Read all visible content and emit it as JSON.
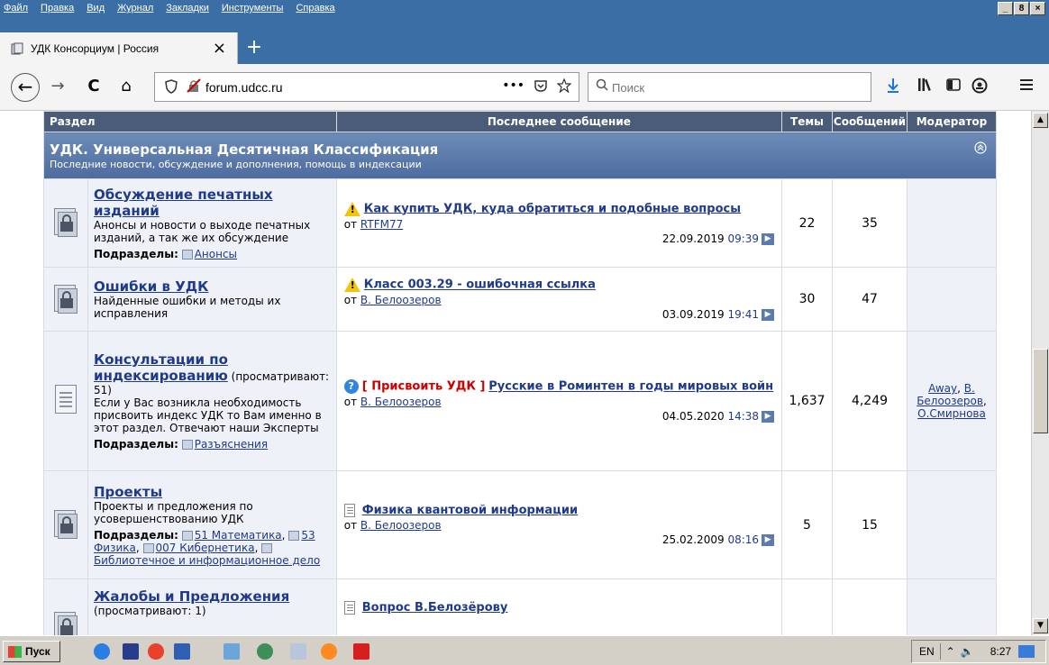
{
  "menubar": {
    "items": [
      "Файл",
      "Правка",
      "Вид",
      "Журнал",
      "Закладки",
      "Инструменты",
      "Справка"
    ],
    "controls": [
      "_",
      "8",
      "×"
    ]
  },
  "tab": {
    "title": "УДК Консорциум | Россия",
    "close": "×",
    "new_tab": "+"
  },
  "nav": {
    "back": "←",
    "forward": "→",
    "reload": "C",
    "home": "⌂",
    "url": "forum.udcc.ru",
    "search_placeholder": "Поиск",
    "page_actions": "•••"
  },
  "table": {
    "headers": {
      "section": "Раздел",
      "last_message": "Последнее сообщение",
      "topics": "Темы",
      "messages": "Сообщений",
      "moderator": "Модератор"
    },
    "category": {
      "title": "УДК. Универсальная Десятичная Классификация",
      "description": "Последние новости, обсуждение и дополнения, помощь в индексации"
    },
    "labels": {
      "subforums": "Подразделы:",
      "from": "от"
    },
    "forums": [
      {
        "name": "Обсуждение печатных изданий",
        "viewers": "",
        "description": "Анонсы и новости о выходе печатных изданий, а так же их обсуждение",
        "subforums": [
          "Анонсы"
        ],
        "last_topic": "Как купить УДК, куда обратиться и подобные вопросы",
        "last_prefix": "",
        "last_author": "RTFM77",
        "last_date": "22.09.2019",
        "last_time": "09:39",
        "topics": "22",
        "messages": "35",
        "moderators": []
      },
      {
        "name": "Ошибки в УДК",
        "viewers": "",
        "description": "Найденные ошибки и методы их исправления",
        "subforums": [],
        "last_topic": "Класс 003.29 - ошибочная ссылка",
        "last_prefix": "",
        "last_author": "В. Белоозеров",
        "last_date": "03.09.2019",
        "last_time": "19:41",
        "topics": "30",
        "messages": "47",
        "moderators": []
      },
      {
        "name": "Консультации по индексированию",
        "viewers": "(просматривают: 51)",
        "description": "Если у Вас возникла необходимость присвоить индекс УДК то Вам именно в этот раздел. Отвечают наши Эксперты",
        "subforums": [
          "Разъяснения"
        ],
        "last_topic": "Русские в Роминтен в годы мировых войн",
        "last_prefix": "[ Присвоить УДК ]",
        "last_author": "В. Белоозеров",
        "last_date": "04.05.2020",
        "last_time": "14:38",
        "topics": "1,637",
        "messages": "4,249",
        "moderators": [
          "Away",
          "В. Белоозеров",
          "О.Смирнова"
        ]
      },
      {
        "name": "Проекты",
        "viewers": "",
        "description": "Проекты и предложения по усовершенствованию УДК",
        "subforums": [
          "51 Математика",
          "53 Физика",
          "007 Кибернетика",
          "Библиотечное и информационное дело"
        ],
        "last_topic": "Физика квантовой информации",
        "last_prefix": "",
        "last_author": "В. Белоозеров",
        "last_date": "25.02.2009",
        "last_time": "08:16",
        "topics": "5",
        "messages": "15",
        "moderators": []
      },
      {
        "name": "Жалобы и Предложения",
        "viewers": "(просматривают: 1)",
        "description": "",
        "subforums": [],
        "last_topic": "Вопрос В.Белозёрову",
        "last_prefix": "",
        "last_author": "",
        "last_date": "",
        "last_time": "",
        "topics": "",
        "messages": "",
        "moderators": []
      }
    ]
  },
  "taskbar": {
    "start": "Пуск",
    "lang": "EN",
    "clock": "8:27"
  }
}
